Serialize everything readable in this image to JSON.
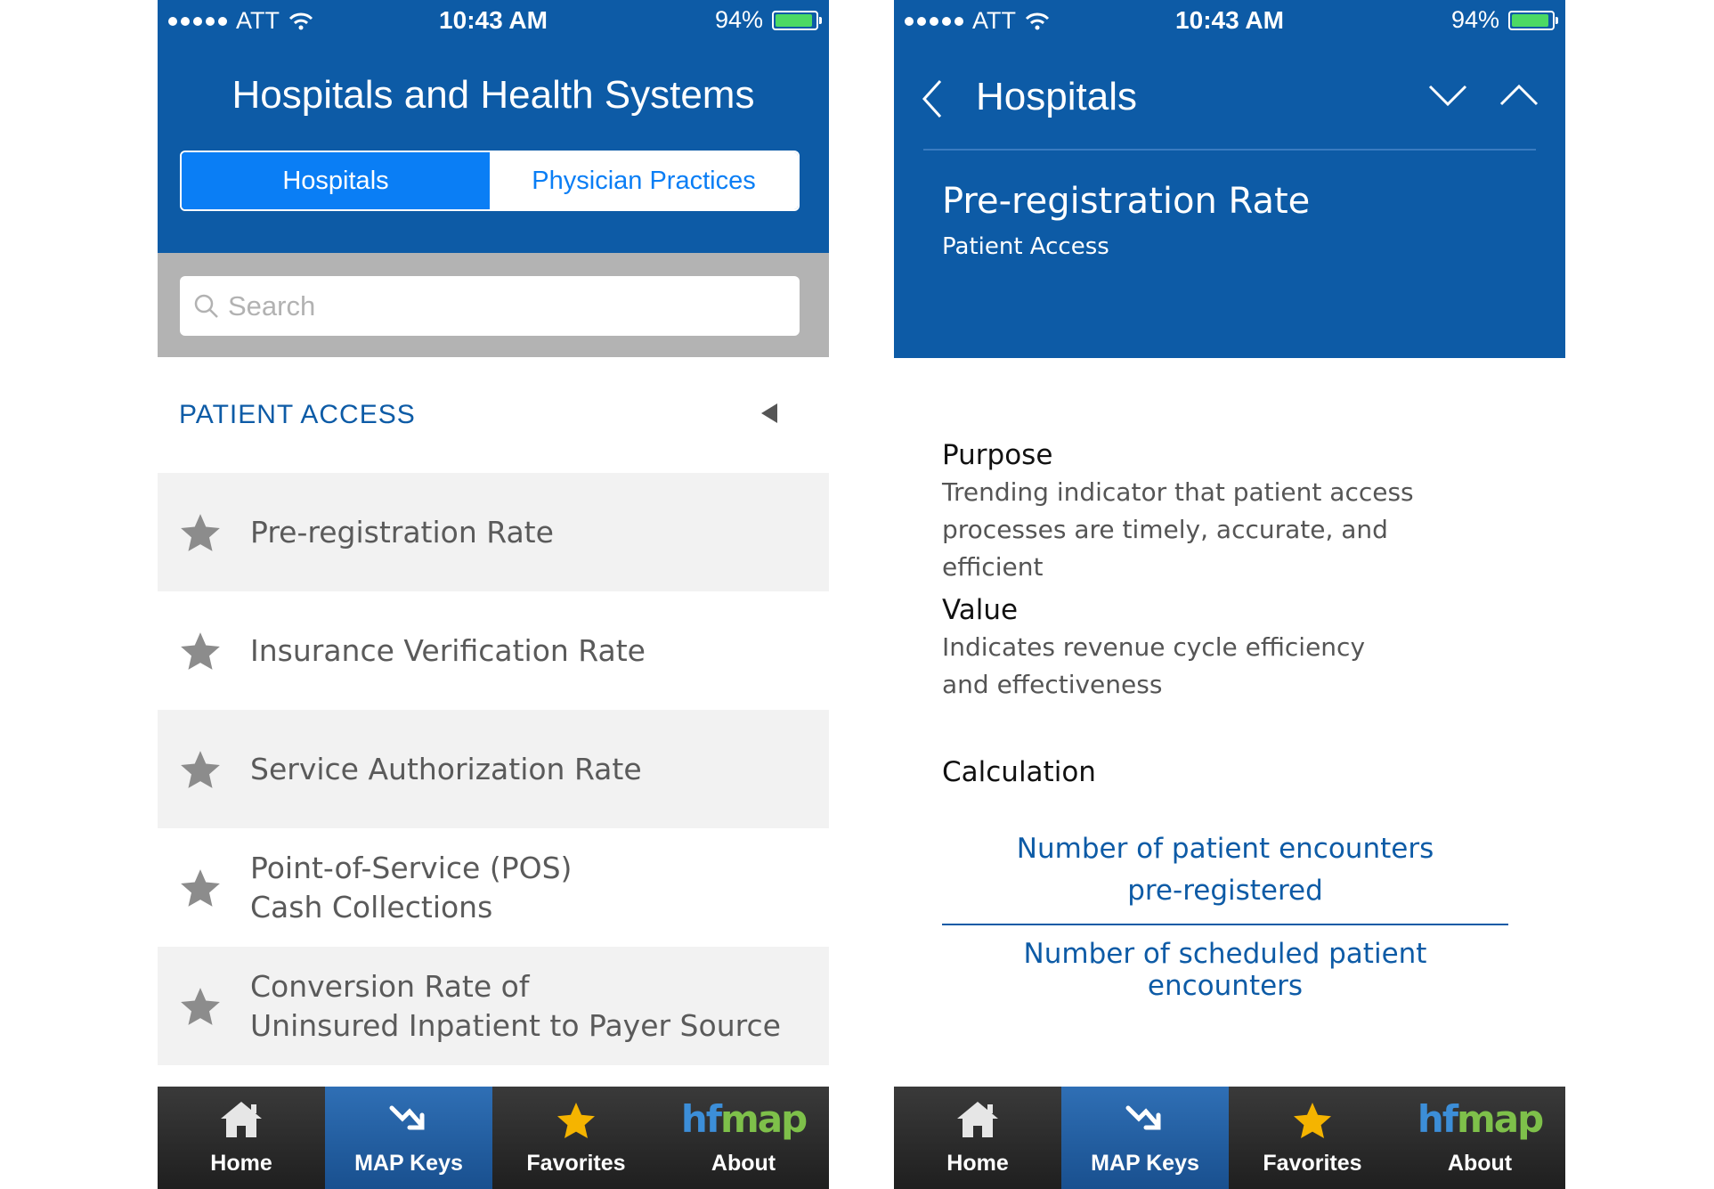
{
  "status": {
    "carrier": "ATT",
    "time": "10:43 AM",
    "battery": "94%",
    "battery_level": 0.94
  },
  "left": {
    "header_title": "Hospitals and Health Systems",
    "segments": [
      "Hospitals",
      "Physician Practices"
    ],
    "search_placeholder": "Search",
    "section_title": "PATIENT ACCESS",
    "metrics": [
      {
        "line1": "Pre-registration Rate",
        "line2": ""
      },
      {
        "line1": "Insurance Verification Rate",
        "line2": ""
      },
      {
        "line1": "Service Authorization Rate",
        "line2": ""
      },
      {
        "line1": "Point-of-Service (POS)",
        "line2": "Cash Collections"
      },
      {
        "line1": "Conversion Rate of",
        "line2": "Uninsured Inpatient to Payer Source"
      }
    ]
  },
  "right": {
    "nav_title": "Hospitals",
    "detail_title": "Pre-registration Rate",
    "detail_subtitle": "Patient Access",
    "purpose_heading": "Purpose",
    "purpose_line1": "Trending indicator that patient access",
    "purpose_line2": "processes are timely, accurate, and efficient",
    "value_heading": "Value",
    "value_line1": "Indicates revenue cycle efficiency",
    "value_line2": "and effectiveness",
    "calc_heading": "Calculation",
    "numerator_line1": "Number of patient encounters",
    "numerator_line2": "pre-registered",
    "denominator": "Number of scheduled patient encounters"
  },
  "tabs": [
    {
      "label": "Home",
      "icon": "home-icon"
    },
    {
      "label": "MAP Keys",
      "icon": "map-keys-arrow-icon"
    },
    {
      "label": "Favorites",
      "icon": "star-icon"
    },
    {
      "label": "About",
      "icon": "hfmap-logo"
    }
  ],
  "logo": {
    "hf": "hf",
    "map": "map"
  },
  "colors": {
    "brand_blue": "#0d5ba6",
    "segment_blue": "#0a7ef5",
    "logo_green": "#7ec04a",
    "star_gold": "#f5b400"
  }
}
